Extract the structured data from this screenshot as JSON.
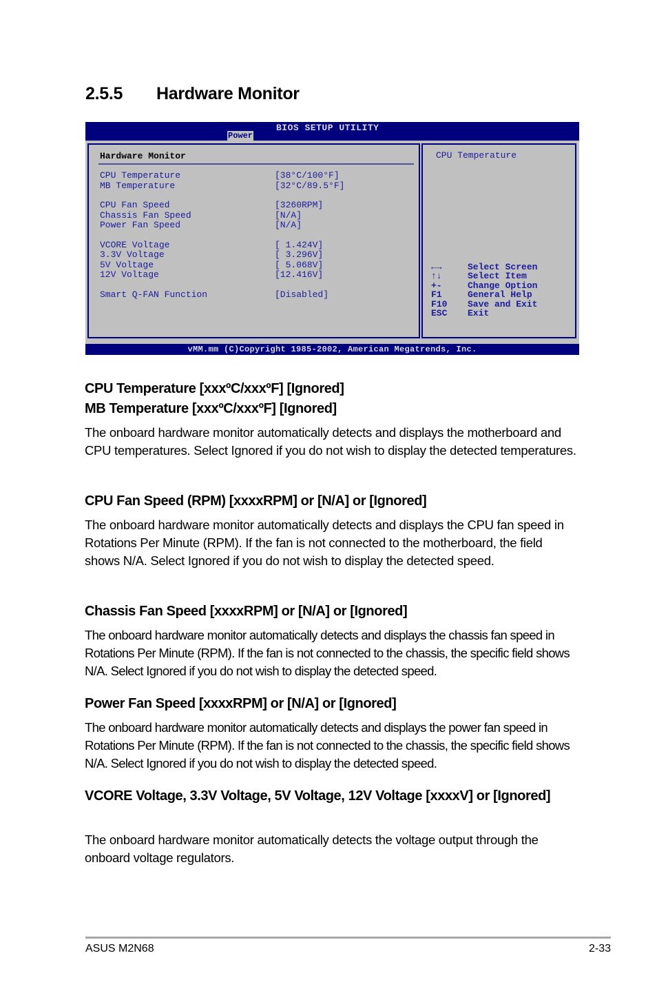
{
  "section": {
    "number": "2.5.5",
    "title": "Hardware Monitor"
  },
  "bios": {
    "title": "BIOS SETUP UTILITY",
    "active_tab": "Power",
    "panel_header": "Hardware Monitor",
    "items": [
      {
        "label": "CPU Temperature",
        "value": "[38°C/100°F]"
      },
      {
        "label": "MB Temperature",
        "value": "[32°C/89.5°F]"
      },
      {
        "label": "CPU Fan Speed",
        "value": "[3260RPM]"
      },
      {
        "label": "Chassis Fan Speed",
        "value": "[N/A]"
      },
      {
        "label": "Power Fan Speed",
        "value": "[N/A]"
      },
      {
        "label": "VCORE Voltage",
        "value": "[ 1.424V]"
      },
      {
        "label": "3.3V Voltage",
        "value": "[ 3.296V]"
      },
      {
        "label": "5V Voltage",
        "value": "[ 5.068V]"
      },
      {
        "label": "12V Voltage",
        "value": "[12.416V]"
      },
      {
        "label": "Smart Q-FAN Function",
        "value": "[Disabled]"
      }
    ],
    "help_text": "CPU Temperature",
    "keys": [
      {
        "key": "←→",
        "desc": "Select Screen"
      },
      {
        "key": "↑↓",
        "desc": "Select Item"
      },
      {
        "key": "+-",
        "desc": "Change Option"
      },
      {
        "key": "F1",
        "desc": "General Help"
      },
      {
        "key": "F10",
        "desc": "Save and Exit"
      },
      {
        "key": "ESC",
        "desc": "Exit"
      }
    ],
    "copyright": "vMM.mm (C)Copyright 1985-2002, American Megatrends, Inc."
  },
  "content": {
    "h_temp1": "CPU Temperature [xxxºC/xxxºF] [Ignored]",
    "h_temp2": "MB Temperature [xxxºC/xxxºF] [Ignored]",
    "p_temp": "The onboard hardware monitor automatically detects and displays the motherboard and CPU temperatures. Select Ignored if you do not wish to display the detected temperatures.",
    "h_cpufan": "CPU Fan Speed (RPM) [xxxxRPM] or [N/A] or [Ignored]",
    "p_cpufan": "The onboard hardware monitor automatically detects and displays the CPU fan speed in Rotations Per Minute (RPM). If the fan is not connected to the motherboard, the field shows N/A. Select Ignored if you do not wish to display the detected speed.",
    "h_chassis": "Chassis Fan Speed [xxxxRPM] or [N/A] or [Ignored]",
    "p_chassis": "The onboard hardware monitor automatically detects and displays the chassis fan speed in Rotations Per Minute (RPM). If the fan is not connected to the chassis, the specific field shows N/A. Select Ignored if you do not wish to display the detected speed.",
    "h_power": "Power Fan Speed [xxxxRPM] or [N/A] or [Ignored]",
    "p_power": "The onboard hardware monitor automatically detects and displays the power fan speed in Rotations Per Minute (RPM). If the fan is not connected to the chassis, the specific field shows N/A. Select Ignored if you do not wish to display the detected speed.",
    "h_voltage": "VCORE Voltage, 3.3V Voltage, 5V Voltage, 12V Voltage [xxxxV] or [Ignored]",
    "p_voltage": "The onboard hardware monitor automatically detects the voltage output through the onboard voltage regulators."
  },
  "footer": {
    "left": "ASUS M2N68",
    "right": "2-33"
  }
}
